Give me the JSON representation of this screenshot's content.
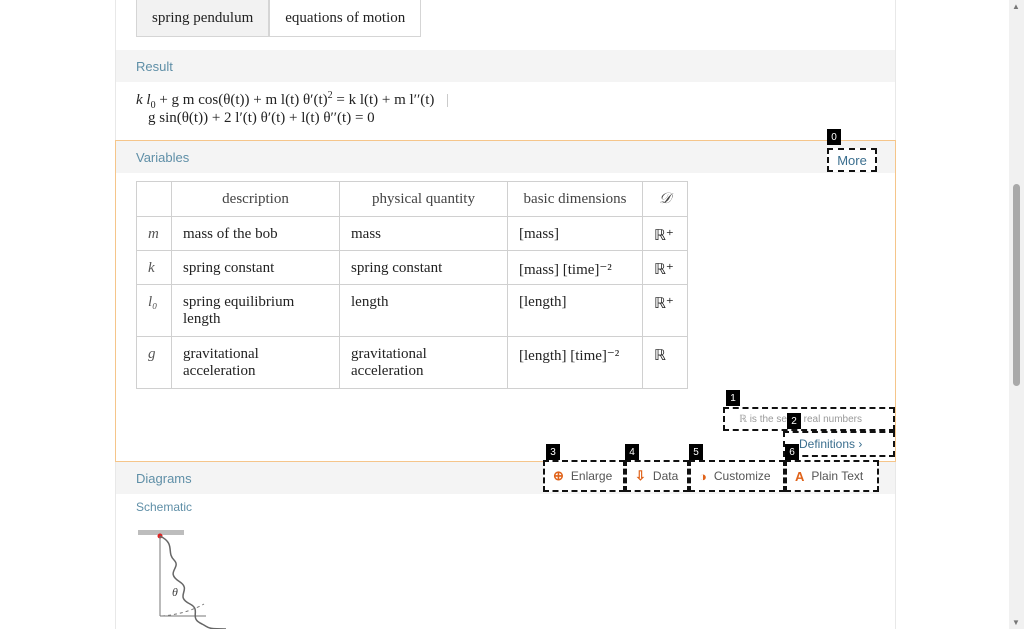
{
  "input": {
    "chips": [
      "spring pendulum",
      "equations of motion"
    ]
  },
  "result": {
    "header": "Result",
    "eq1_parts": [
      "k l",
      "0",
      " + g m cos(θ(t)) + m l(t) θ′(t)",
      "2",
      " = k l(t) + m l′′(t)"
    ],
    "eq1_sep": "|",
    "eq2": "g sin(θ(t)) + 2 l′(t) θ′(t) + l(t) θ′′(t) = 0"
  },
  "variables": {
    "header": "Variables",
    "more_label": "More",
    "columns": [
      "description",
      "physical quantity",
      "basic dimensions",
      "𝒟"
    ],
    "rows": [
      {
        "symbol": "m",
        "description": "mass of the bob",
        "quantity": "mass",
        "dimensions": "[mass]",
        "domain": "ℝ⁺"
      },
      {
        "symbol": "k",
        "description": "spring constant",
        "quantity": "spring constant",
        "dimensions": "[mass] [time]⁻²",
        "domain": "ℝ⁺"
      },
      {
        "symbol": "l₀",
        "description": "spring equilibrium length",
        "quantity": "length",
        "dimensions": "[length]",
        "domain": "ℝ⁺"
      },
      {
        "symbol": "g",
        "description": "gravitational acceleration",
        "quantity": "gravitational acceleration",
        "dimensions": "[length] [time]⁻²",
        "domain": "ℝ"
      }
    ],
    "real_note": "ℝ is the set of real numbers",
    "definitions_label": "Definitions ›"
  },
  "toolbar": {
    "enlarge": "Enlarge",
    "data": "Data",
    "customize": "Customize",
    "plain_text": "Plain Text"
  },
  "diagrams": {
    "header": "Diagrams",
    "schematic_label": "Schematic",
    "theta_label": "θ"
  },
  "badges": [
    "0",
    "1",
    "2",
    "3",
    "4",
    "5",
    "6"
  ],
  "colors": {
    "accent": "#e0631a",
    "pod_header_text": "#5f8fa7",
    "selected_border": "#f5c58a"
  }
}
